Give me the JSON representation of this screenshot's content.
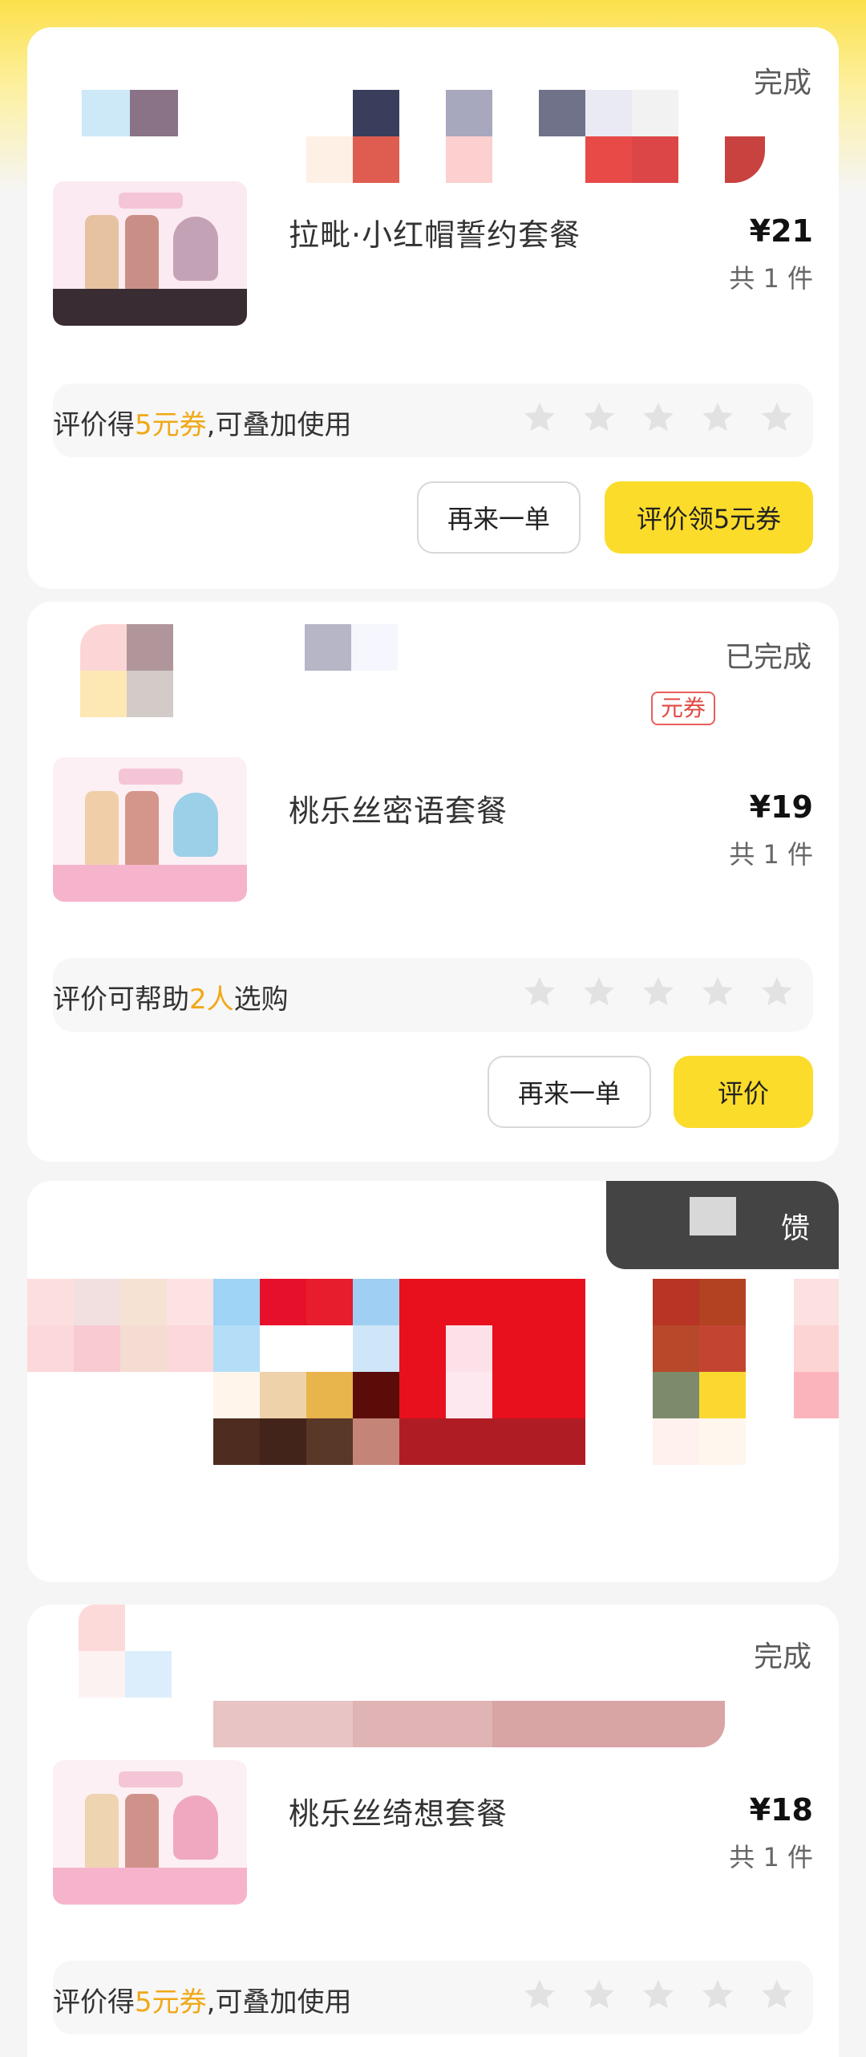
{
  "orders": [
    {
      "status": "完成",
      "product_name": "拉毗·小红帽誓约套餐",
      "price": "¥21",
      "quantity": "共 1 件",
      "review_prefix": "评价得",
      "review_highlight": "5元券",
      "review_suffix": ",可叠加使用",
      "btn_reorder": "再来一单",
      "btn_review": "评价领5元券"
    },
    {
      "status": "已完成",
      "coupon_tag": "元券",
      "product_name": "桃乐丝密语套餐",
      "price": "¥19",
      "quantity": "共 1 件",
      "review_prefix": "评价可帮助",
      "review_highlight": "2人",
      "review_suffix": "选购",
      "btn_reorder": "再来一单",
      "btn_review": "评价"
    },
    {
      "feedback_label": "馈"
    },
    {
      "status": "完成",
      "product_name": "桃乐丝绮想套餐",
      "price": "¥18",
      "quantity": "共 1 件",
      "review_prefix": "评价得",
      "review_highlight": "5元券",
      "review_suffix": ",可叠加使用"
    }
  ],
  "colors": {
    "accent_yellow": "#fbdc2b",
    "highlight_orange": "#f0a818",
    "star_gray": "#e2e2e2"
  }
}
